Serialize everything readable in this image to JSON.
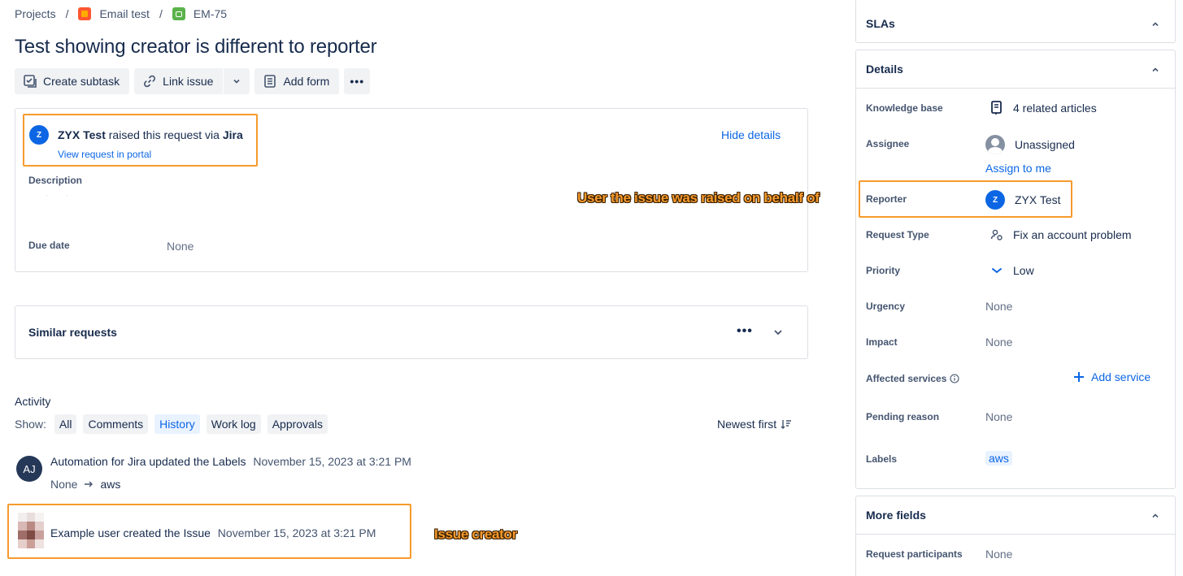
{
  "breadcrumb": {
    "projects": "Projects",
    "project": "Email test",
    "issue_key": "EM-75",
    "separator": "/"
  },
  "issue": {
    "title": "Test showing creator is different to reporter"
  },
  "toolbar": {
    "create_subtask": "Create subtask",
    "link_issue": "Link issue",
    "add_form": "Add form",
    "more": "•••"
  },
  "request": {
    "avatar_initial": "Z",
    "raiser_name": "ZYX Test",
    "raised_text": "raised this request via",
    "via": "Jira",
    "view_portal": "View request in portal",
    "hide_details": "Hide details",
    "description_label": "Description",
    "description_value": "· ·",
    "due_date_label": "Due date",
    "due_date_value": "None"
  },
  "similar": {
    "label": "Similar requests",
    "more": "•••"
  },
  "activity": {
    "label": "Activity",
    "show_label": "Show:",
    "filters": [
      "All",
      "Comments",
      "History",
      "Work log",
      "Approvals"
    ],
    "active_filter": "History",
    "sort": "Newest first",
    "entries": [
      {
        "avatar": "AJ",
        "actor": "Automation for Jira",
        "action": "updated the",
        "object": "Labels",
        "date": "November 15, 2023 at 3:21 PM",
        "from": "None",
        "to": "aws"
      },
      {
        "actor": "Example user",
        "action": "created the",
        "object": "Issue",
        "date": "November 15, 2023 at 3:21 PM"
      }
    ]
  },
  "callouts": {
    "reporter": "User the issue was raised on behalf of",
    "creator": "Issue creator"
  },
  "sidebar": {
    "slas": "SLAs",
    "details": "Details",
    "more_fields": "More fields",
    "fields": {
      "knowledge_base": {
        "label": "Knowledge base",
        "value": "4 related articles"
      },
      "assignee": {
        "label": "Assignee",
        "value": "Unassigned",
        "action": "Assign to me"
      },
      "reporter": {
        "label": "Reporter",
        "value": "ZYX Test",
        "avatar": "Z"
      },
      "request_type": {
        "label": "Request Type",
        "value": "Fix an account problem"
      },
      "priority": {
        "label": "Priority",
        "value": "Low"
      },
      "urgency": {
        "label": "Urgency",
        "value": "None"
      },
      "impact": {
        "label": "Impact",
        "value": "None"
      },
      "affected_services": {
        "label": "Affected services",
        "action": "Add service"
      },
      "pending_reason": {
        "label": "Pending reason",
        "value": "None"
      },
      "labels": {
        "label": "Labels",
        "value": "aws"
      },
      "request_participants": {
        "label": "Request participants",
        "value": "None"
      }
    }
  },
  "colors": {
    "highlight": "#f79a2d",
    "link": "#0c66e4",
    "avatar_blue": "#0c66e4",
    "aj_avatar": "#253858"
  },
  "icons": [
    "project-icon",
    "issue-type-icon",
    "subtask-icon",
    "link-icon",
    "chevron-down-icon",
    "form-icon",
    "more-icon",
    "chevron-up-icon",
    "article-icon",
    "user-icon",
    "request-type-icon",
    "priority-low-icon",
    "info-icon",
    "plus-icon",
    "sort-icon",
    "arrow-right-icon"
  ]
}
